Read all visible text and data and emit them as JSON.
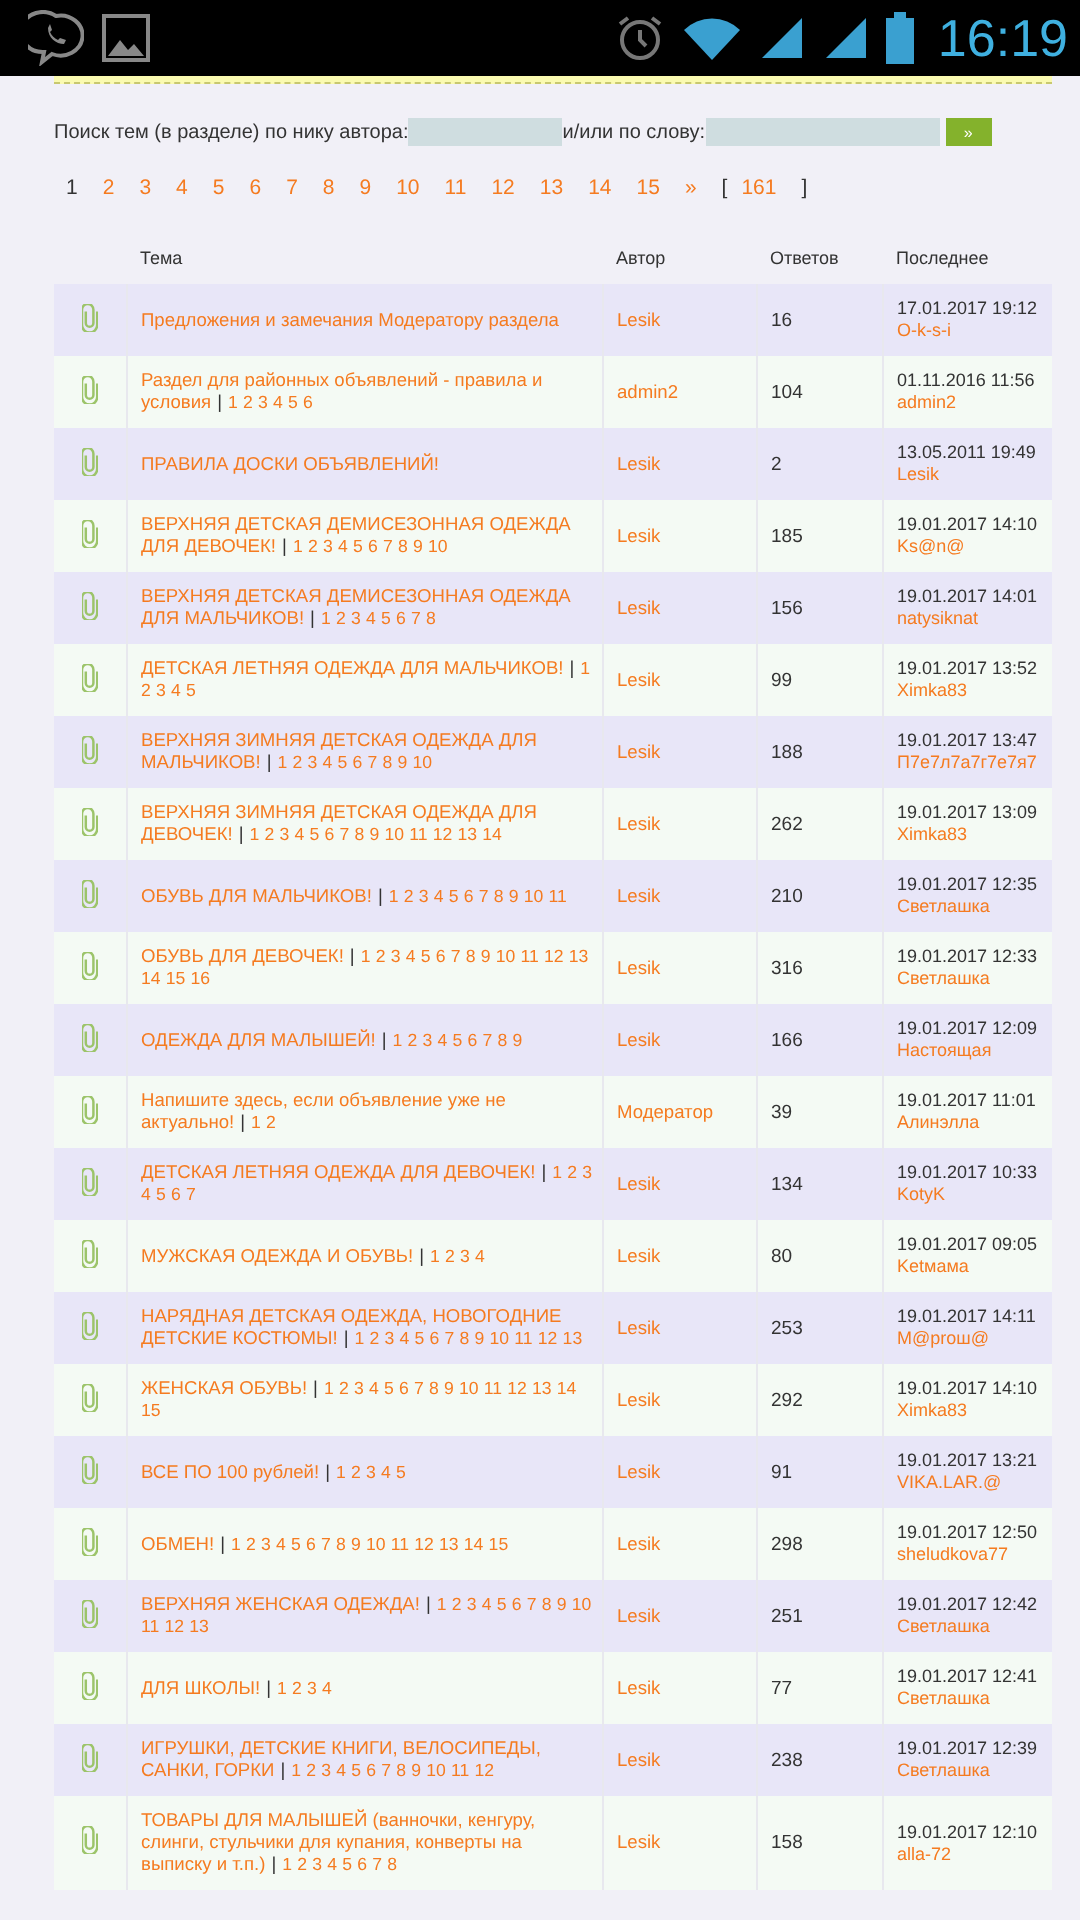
{
  "status_bar": {
    "time": "16:19"
  },
  "search": {
    "label_author": "Поиск тем (в разделе) по нику автора:",
    "label_word": "и/или по слову:",
    "submit": "»"
  },
  "pagination": {
    "pages": [
      {
        "label": "1",
        "selected": true
      },
      {
        "label": "2",
        "selected": false
      },
      {
        "label": "3",
        "selected": false
      },
      {
        "label": "4",
        "selected": false
      },
      {
        "label": "5",
        "selected": false
      },
      {
        "label": "6",
        "selected": false
      },
      {
        "label": "7",
        "selected": false
      },
      {
        "label": "8",
        "selected": false
      },
      {
        "label": "9",
        "selected": false
      },
      {
        "label": "10",
        "selected": false
      },
      {
        "label": "11",
        "selected": false
      },
      {
        "label": "12",
        "selected": false
      },
      {
        "label": "13",
        "selected": false
      },
      {
        "label": "14",
        "selected": false
      },
      {
        "label": "15",
        "selected": false
      }
    ],
    "next": "»",
    "bracket_open": "[",
    "last": "161",
    "bracket_close": "]"
  },
  "table": {
    "columns": [
      "Тема",
      "Автор",
      "Ответов",
      "Последнее"
    ],
    "separator": "|",
    "rows": [
      {
        "title": "Предложения и замечания Модератору раздела",
        "pages": [],
        "author": "Lesik",
        "replies": "16",
        "date": "17.01.2017 19:12",
        "last_author": "O-k-s-i"
      },
      {
        "title": "Раздел для районных объявлений - правила и условия",
        "pages": [
          "1",
          "2",
          "3",
          "4",
          "5",
          "6"
        ],
        "author": "admin2",
        "replies": "104",
        "date": "01.11.2016 11:56",
        "last_author": "admin2"
      },
      {
        "title": "ПРАВИЛА ДОСКИ ОБЪЯВЛЕНИЙ!",
        "pages": [],
        "author": "Lesik",
        "replies": "2",
        "date": "13.05.2011 19:49",
        "last_author": "Lesik"
      },
      {
        "title": "ВЕРХНЯЯ ДЕТСКАЯ ДЕМИСЕЗОННАЯ ОДЕЖДА ДЛЯ ДЕВОЧЕК!",
        "pages": [
          "1",
          "2",
          "3",
          "4",
          "5",
          "6",
          "7",
          "8",
          "9",
          "10"
        ],
        "author": "Lesik",
        "replies": "185",
        "date": "19.01.2017 14:10",
        "last_author": "Ks@n@"
      },
      {
        "title": "ВЕРХНЯЯ ДЕТСКАЯ ДЕМИСЕЗОННАЯ ОДЕЖДА ДЛЯ МАЛЬЧИКОВ!",
        "pages": [
          "1",
          "2",
          "3",
          "4",
          "5",
          "6",
          "7",
          "8"
        ],
        "author": "Lesik",
        "replies": "156",
        "date": "19.01.2017 14:01",
        "last_author": "natysiknat"
      },
      {
        "title": "ДЕТСКАЯ ЛЕТНЯЯ ОДЕЖДА ДЛЯ МАЛЬЧИКОВ!",
        "pages": [
          "1",
          "2",
          "3",
          "4",
          "5"
        ],
        "author": "Lesik",
        "replies": "99",
        "date": "19.01.2017 13:52",
        "last_author": "Ximka83"
      },
      {
        "title": "ВЕРХНЯЯ ЗИМНЯЯ ДЕТСКАЯ ОДЕЖДА ДЛЯ МАЛЬЧИКОВ!",
        "pages": [
          "1",
          "2",
          "3",
          "4",
          "5",
          "6",
          "7",
          "8",
          "9",
          "10"
        ],
        "author": "Lesik",
        "replies": "188",
        "date": "19.01.2017 13:47",
        "last_author": "П7е7л7а7г7е7я7"
      },
      {
        "title": "ВЕРХНЯЯ ЗИМНЯЯ ДЕТСКАЯ ОДЕЖДА ДЛЯ ДЕВОЧЕК!",
        "pages": [
          "1",
          "2",
          "3",
          "4",
          "5",
          "6",
          "7",
          "8",
          "9",
          "10",
          "11",
          "12",
          "13",
          "14"
        ],
        "author": "Lesik",
        "replies": "262",
        "date": "19.01.2017 13:09",
        "last_author": "Ximka83"
      },
      {
        "title": "ОБУВЬ ДЛЯ МАЛЬЧИКОВ!",
        "pages": [
          "1",
          "2",
          "3",
          "4",
          "5",
          "6",
          "7",
          "8",
          "9",
          "10",
          "11"
        ],
        "author": "Lesik",
        "replies": "210",
        "date": "19.01.2017 12:35",
        "last_author": "Светлашка"
      },
      {
        "title": "ОБУВЬ ДЛЯ ДЕВОЧЕК!",
        "pages": [
          "1",
          "2",
          "3",
          "4",
          "5",
          "6",
          "7",
          "8",
          "9",
          "10",
          "11",
          "12",
          "13",
          "14",
          "15",
          "16"
        ],
        "author": "Lesik",
        "replies": "316",
        "date": "19.01.2017 12:33",
        "last_author": "Светлашка"
      },
      {
        "title": "ОДЕЖДА ДЛЯ МАЛЫШЕЙ!",
        "pages": [
          "1",
          "2",
          "3",
          "4",
          "5",
          "6",
          "7",
          "8",
          "9"
        ],
        "author": "Lesik",
        "replies": "166",
        "date": "19.01.2017 12:09",
        "last_author": "Настоящая"
      },
      {
        "title": "Напишите здесь, если объявление уже не актуально!",
        "pages": [
          "1",
          "2"
        ],
        "author": "Модератор",
        "replies": "39",
        "date": "19.01.2017 11:01",
        "last_author": "Алинэлла"
      },
      {
        "title": "ДЕТСКАЯ ЛЕТНЯЯ ОДЕЖДА ДЛЯ ДЕВОЧЕК!",
        "pages": [
          "1",
          "2",
          "3",
          "4",
          "5",
          "6",
          "7"
        ],
        "author": "Lesik",
        "replies": "134",
        "date": "19.01.2017 10:33",
        "last_author": "KotyK"
      },
      {
        "title": "МУЖСКАЯ ОДЕЖДА И ОБУВЬ!",
        "pages": [
          "1",
          "2",
          "3",
          "4"
        ],
        "author": "Lesik",
        "replies": "80",
        "date": "19.01.2017 09:05",
        "last_author": "Ketмама"
      },
      {
        "title": "НАРЯДНАЯ ДЕТСКАЯ ОДЕЖДА, НОВОГОДНИЕ ДЕТСКИЕ КОСТЮМЫ!",
        "pages": [
          "1",
          "2",
          "3",
          "4",
          "5",
          "6",
          "7",
          "8",
          "9",
          "10",
          "11",
          "12",
          "13"
        ],
        "author": "Lesik",
        "replies": "253",
        "date": "19.01.2017 14:11",
        "last_author": "M@prош@"
      },
      {
        "title": "ЖЕНСКАЯ ОБУВЬ!",
        "pages": [
          "1",
          "2",
          "3",
          "4",
          "5",
          "6",
          "7",
          "8",
          "9",
          "10",
          "11",
          "12",
          "13",
          "14",
          "15"
        ],
        "author": "Lesik",
        "replies": "292",
        "date": "19.01.2017 14:10",
        "last_author": "Ximka83"
      },
      {
        "title": "ВСЕ ПО 100 рублей!",
        "pages": [
          "1",
          "2",
          "3",
          "4",
          "5"
        ],
        "author": "Lesik",
        "replies": "91",
        "date": "19.01.2017 13:21",
        "last_author": "VIKA.LAR.@"
      },
      {
        "title": "ОБМЕН!",
        "pages": [
          "1",
          "2",
          "3",
          "4",
          "5",
          "6",
          "7",
          "8",
          "9",
          "10",
          "11",
          "12",
          "13",
          "14",
          "15"
        ],
        "author": "Lesik",
        "replies": "298",
        "date": "19.01.2017 12:50",
        "last_author": "sheludkova77"
      },
      {
        "title": "ВЕРХНЯЯ ЖЕНСКАЯ ОДЕЖДА!",
        "pages": [
          "1",
          "2",
          "3",
          "4",
          "5",
          "6",
          "7",
          "8",
          "9",
          "10",
          "11",
          "12",
          "13"
        ],
        "author": "Lesik",
        "replies": "251",
        "date": "19.01.2017 12:42",
        "last_author": "Светлашка"
      },
      {
        "title": "ДЛЯ ШКОЛЫ!",
        "pages": [
          "1",
          "2",
          "3",
          "4"
        ],
        "author": "Lesik",
        "replies": "77",
        "date": "19.01.2017 12:41",
        "last_author": "Светлашка"
      },
      {
        "title": "ИГРУШКИ, ДЕТСКИЕ КНИГИ, ВЕЛОСИПЕДЫ, САНКИ, ГОРКИ",
        "pages": [
          "1",
          "2",
          "3",
          "4",
          "5",
          "6",
          "7",
          "8",
          "9",
          "10",
          "11",
          "12"
        ],
        "author": "Lesik",
        "replies": "238",
        "date": "19.01.2017 12:39",
        "last_author": "Светлашка"
      },
      {
        "title": "ТОВАРЫ ДЛЯ МАЛЫШЕЙ (ванночки, кенгуру, слинги, стульчики для купания, конверты на выписку и т.п.)",
        "pages": [
          "1",
          "2",
          "3",
          "4",
          "5",
          "6",
          "7",
          "8"
        ],
        "author": "Lesik",
        "replies": "158",
        "date": "19.01.2017 12:10",
        "last_author": "alla-72"
      }
    ]
  }
}
